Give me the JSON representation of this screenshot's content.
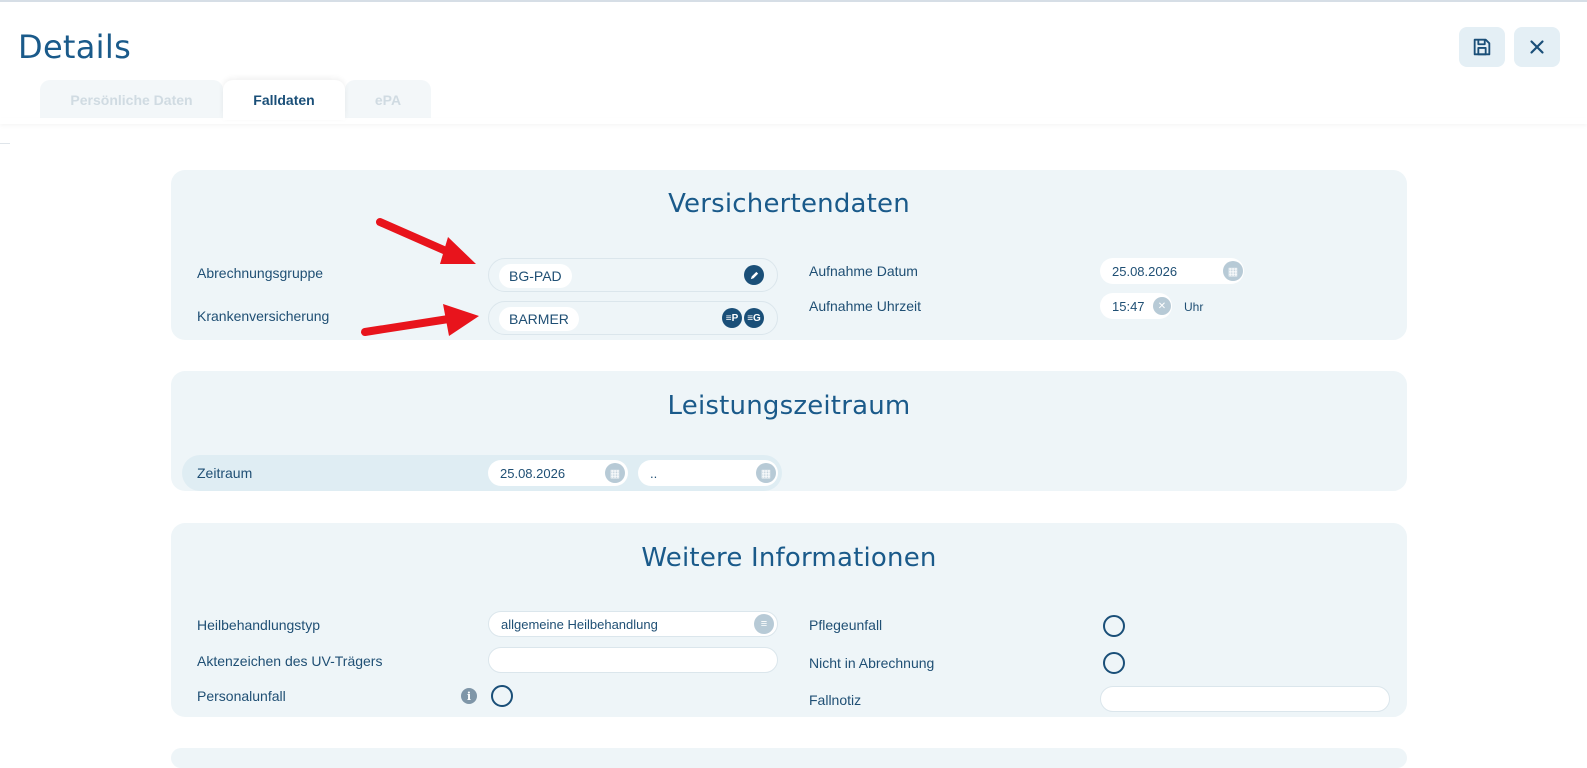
{
  "header": {
    "title": "Details",
    "save_icon": "save-icon",
    "close_icon": "close-icon"
  },
  "tabs": [
    {
      "label": "Persönliche Daten",
      "active": false
    },
    {
      "label": "Falldaten",
      "active": true
    },
    {
      "label": "ePA",
      "active": false
    }
  ],
  "versichertendaten": {
    "title": "Versichertendaten",
    "abrechnungsgruppe": {
      "label": "Abrechnungsgruppe",
      "value": "BG-PAD"
    },
    "krankenversicherung": {
      "label": "Krankenversicherung",
      "value": "BARMER",
      "badge_p": "P",
      "badge_g": "G"
    },
    "aufnahme_datum": {
      "label": "Aufnahme Datum",
      "value": "25.08.2026"
    },
    "aufnahme_uhrzeit": {
      "label": "Aufnahme Uhrzeit",
      "value": "15:47",
      "unit": "Uhr"
    }
  },
  "leistungszeitraum": {
    "title": "Leistungszeitraum",
    "zeitraum": {
      "label": "Zeitraum",
      "from": "25.08.2026",
      "to": ".."
    }
  },
  "weitere": {
    "title": "Weitere Informationen",
    "heilbehandlungstyp": {
      "label": "Heilbehandlungstyp",
      "value": "allgemeine Heilbehandlung"
    },
    "aktenzeichen": {
      "label": "Aktenzeichen des UV-Trägers",
      "value": ""
    },
    "personalunfall": {
      "label": "Personalunfall",
      "checked": false
    },
    "pflegeunfall": {
      "label": "Pflegeunfall",
      "checked": false
    },
    "nicht_in_abrechnung": {
      "label": "Nicht in Abrechnung",
      "checked": false
    },
    "fallnotiz": {
      "label": "Fallnotiz",
      "value": ""
    }
  },
  "colors": {
    "accent": "#1a4f78",
    "card_bg": "#eef5f8",
    "annotation_arrow": "#e8141c"
  }
}
